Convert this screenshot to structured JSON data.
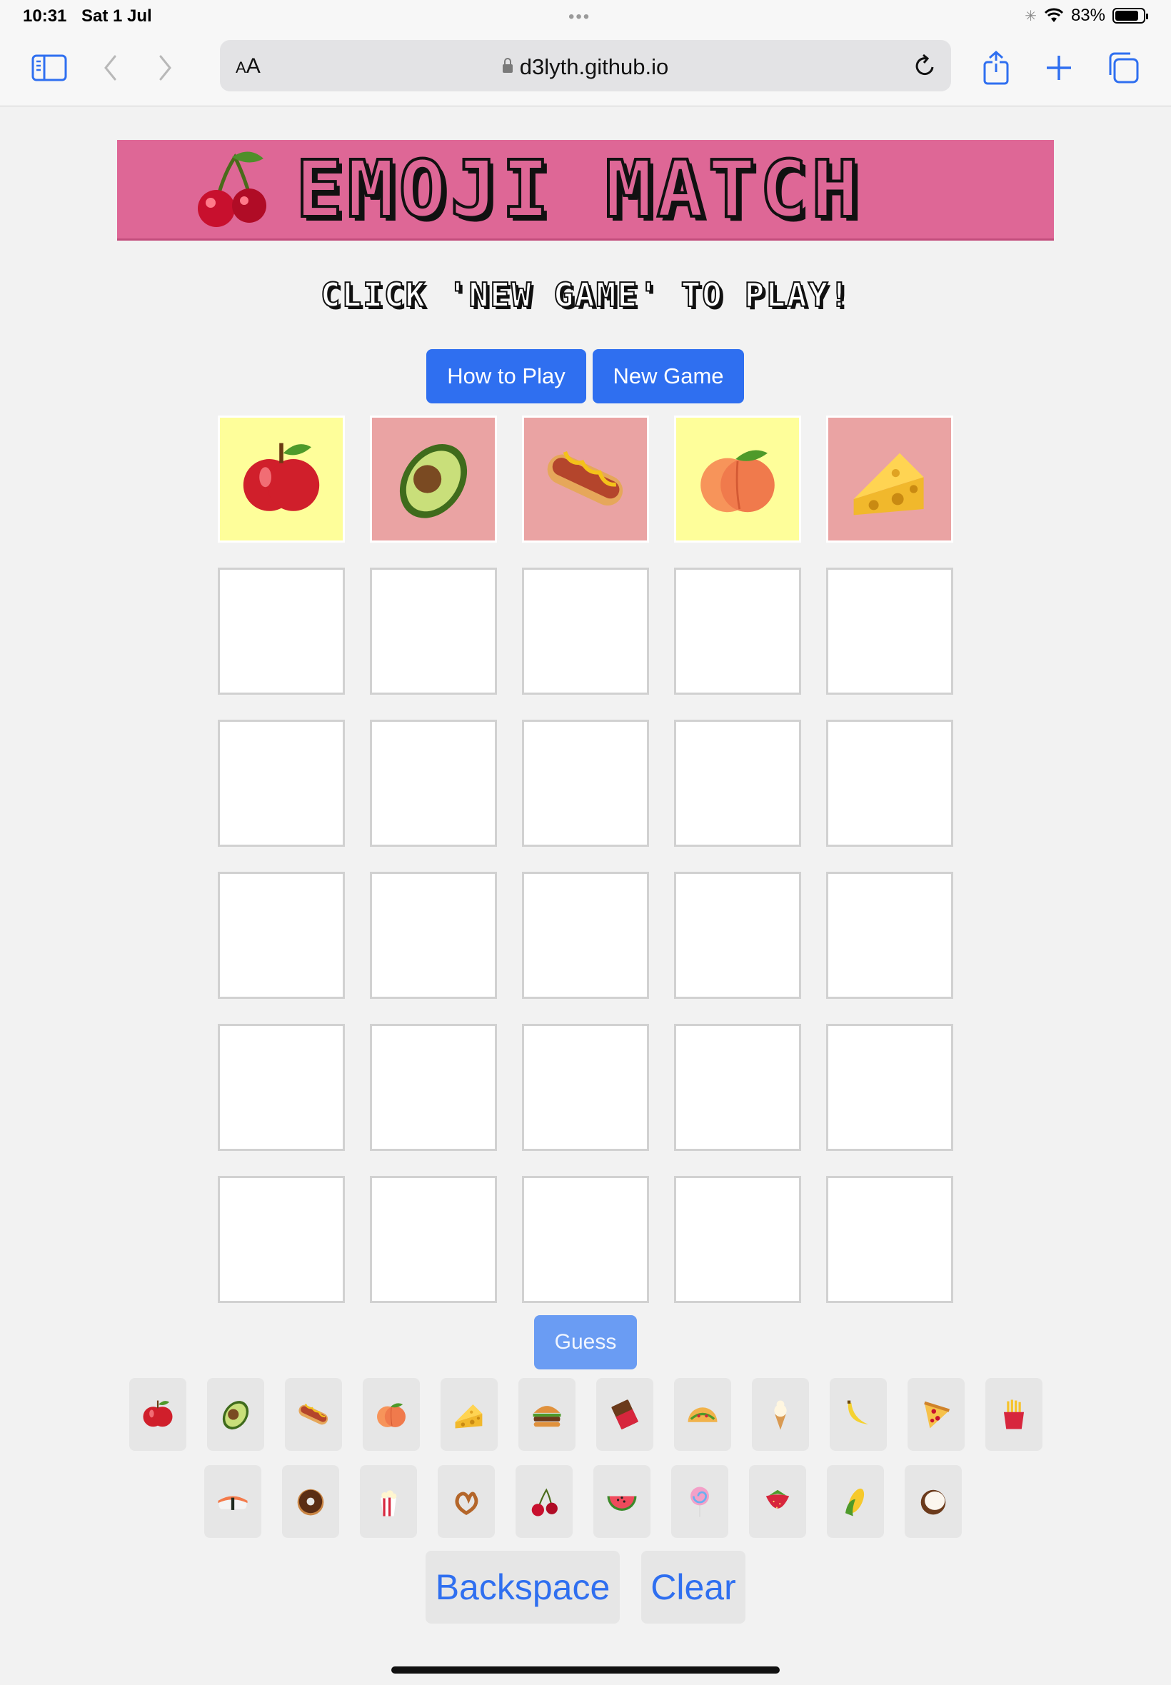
{
  "status_bar": {
    "time": "10:31",
    "date": "Sat 1 Jul",
    "battery": "83%",
    "battery_level": 0.83
  },
  "browser": {
    "url": "d3lyth.github.io",
    "text_size_label_small": "A",
    "text_size_label_large": "A"
  },
  "header": {
    "title": "EMOJI MATCH",
    "emoji": "cherries"
  },
  "subtitle": "CLICK 'NEW GAME' TO PLAY!",
  "buttons": {
    "how_to_play": "How to Play",
    "new_game": "New Game",
    "guess": "Guess",
    "backspace": "Backspace",
    "clear": "Clear"
  },
  "board": {
    "target_row": [
      {
        "emoji": "apple",
        "bg": "yellow"
      },
      {
        "emoji": "avocado",
        "bg": "pink"
      },
      {
        "emoji": "hot dog",
        "bg": "pink"
      },
      {
        "emoji": "peach",
        "bg": "yellow"
      },
      {
        "emoji": "cheese",
        "bg": "pink"
      }
    ],
    "empty_rows": 5,
    "columns": 5
  },
  "keyboard": {
    "row1": [
      "apple",
      "avocado",
      "hot dog",
      "peach",
      "cheese",
      "burger",
      "chocolate",
      "taco",
      "ice cream",
      "banana",
      "pizza",
      "fries"
    ],
    "row2": [
      "sushi",
      "donut",
      "popcorn",
      "pretzel",
      "cherries",
      "watermelon",
      "lollipop",
      "strawberry",
      "corn",
      "coconut"
    ]
  },
  "colors": {
    "accent": "#2f6ff0",
    "banner": "#de6796",
    "tile_yellow": "#fefe9a",
    "tile_pink": "#eaa3a3"
  }
}
